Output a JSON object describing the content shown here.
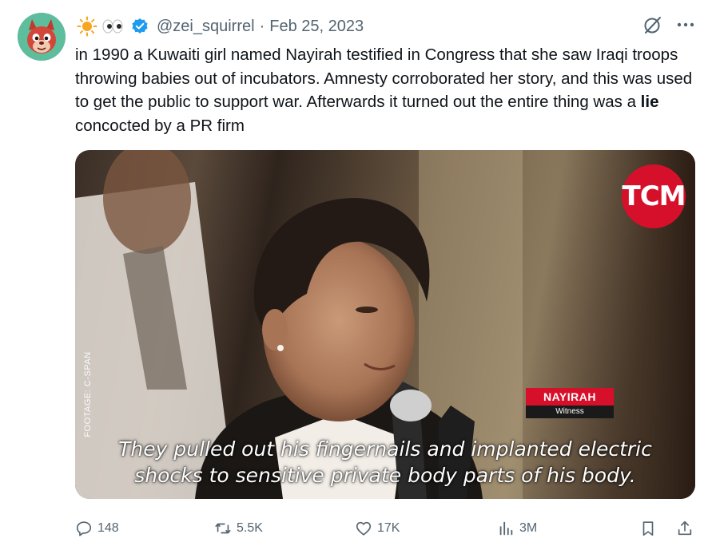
{
  "author": {
    "name_emojis": [
      "☀️",
      "👀"
    ],
    "handle": "@zei_squirrel",
    "separator": "·",
    "date": "Feb 25, 2023"
  },
  "tweet": {
    "text_before": "in 1990 a Kuwaiti girl named Nayirah testified in Congress that she saw Iraqi troops throwing babies out of incubators. Amnesty corroborated her story, and this was used to get the public to support war. Afterwards it turned out the entire thing was a ",
    "text_bold": "lie",
    "text_after": " concocted by a PR firm"
  },
  "media": {
    "logo": "TCM",
    "footage_credit": "FOOTAGE: C-SPAN",
    "lower_third_name": "NAYIRAH",
    "lower_third_role": "Witness",
    "caption_line1": "They pulled out his fingernails and implanted electric",
    "caption_line2": "shocks to sensitive private body parts of his body."
  },
  "actions": {
    "replies": "148",
    "retweets": "5.5K",
    "likes": "17K",
    "views": "3M"
  },
  "colors": {
    "verified": "#1d9bf0",
    "muted": "#536471",
    "tcm_red": "#d6102a"
  }
}
